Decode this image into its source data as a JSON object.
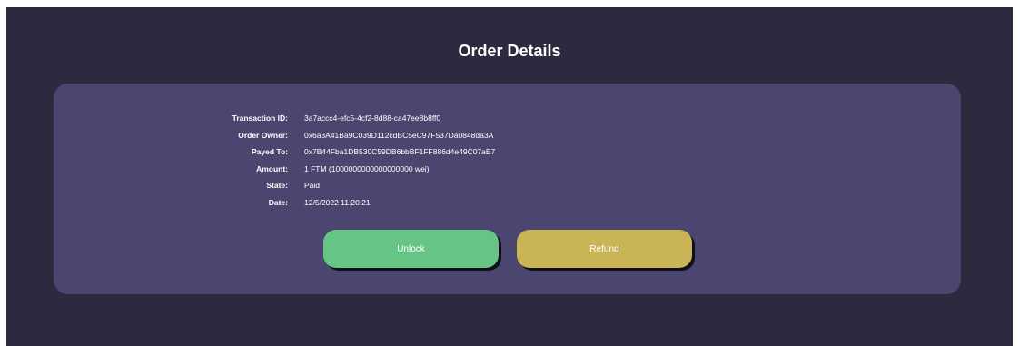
{
  "page": {
    "title": "Order Details"
  },
  "order": {
    "rows": [
      {
        "label": "Transaction ID:",
        "value": "3a7accc4-efc5-4cf2-8d88-ca47ee8b8ff0"
      },
      {
        "label": "Order Owner:",
        "value": "0x6a3A41Ba9C039D112cdBC5eC97F537Da0848da3A"
      },
      {
        "label": "Payed To:",
        "value": "0x7B44Fba1DB530C59DB6bbBF1FF886d4e49C07aE7"
      },
      {
        "label": "Amount:",
        "value": "1 FTM (1000000000000000000 wei)"
      },
      {
        "label": "State:",
        "value": "Paid"
      },
      {
        "label": "Date:",
        "value": "12/5/2022 11:20:21"
      }
    ]
  },
  "actions": {
    "unlock_label": "Unlock",
    "refund_label": "Refund"
  },
  "colors": {
    "background": "#2d2a3f",
    "card": "#4b4670",
    "unlock": "#66c487",
    "refund": "#c9b456"
  }
}
